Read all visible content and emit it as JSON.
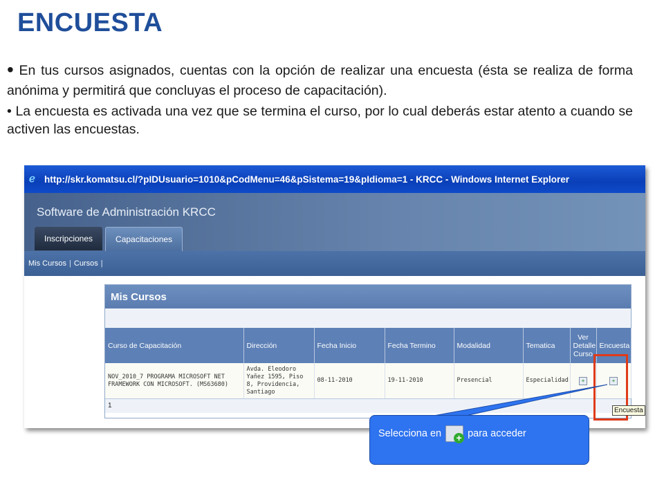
{
  "slide": {
    "title": "ENCUESTA",
    "bullet1": "En tus cursos asignados, cuentas con la opción de realizar una encuesta (ésta se realiza de forma anónima y permitirá que concluyas el proceso de capacitación).",
    "bullet2": "La encuesta es activada una vez que se termina el curso, por lo cual deberás estar atento a cuando se activen las encuestas.",
    "bullet_symbol": "•"
  },
  "browser": {
    "window_title": "http://skr.komatsu.cl/?pIDUsuario=1010&pCodMenu=46&pSistema=19&pIdioma=1 - KRCC - Windows Internet Explorer"
  },
  "app": {
    "name": "Software de Administración KRCC",
    "tabs": [
      {
        "label": "Inscripciones",
        "active": false
      },
      {
        "label": "Capacitaciones",
        "active": true
      }
    ],
    "subnav": [
      "Mis Cursos",
      "Cursos"
    ]
  },
  "panel": {
    "title": "Mis Cursos",
    "columns": [
      "Curso de Capacitación",
      "Dirección",
      "Fecha Inicio",
      "Fecha Termino",
      "Modalidad",
      "Tematica",
      "Ver Detalle Curso",
      "Encuesta"
    ],
    "row": {
      "curso": "NOV_2010_7 PROGRAMA MICROSOFT NET FRAMEWORK CON MICROSOFT. (MS63680)",
      "direccion": "Avda. Eleodoro Yañez 1595, Piso 8, Providencia, Santiago",
      "fecha_inicio": "08-11-2010",
      "fecha_termino": "19-11-2010",
      "modalidad": "Presencial",
      "tematica": "Especialidad"
    },
    "pager": "1"
  },
  "tooltip": "Encuesta",
  "callout": {
    "before": "Selecciona en",
    "after": "para acceder",
    "icon": "survey-add-icon"
  },
  "colors": {
    "title": "#1f4e9a",
    "callout": "#2e73ef",
    "highlight": "#e03a18"
  }
}
